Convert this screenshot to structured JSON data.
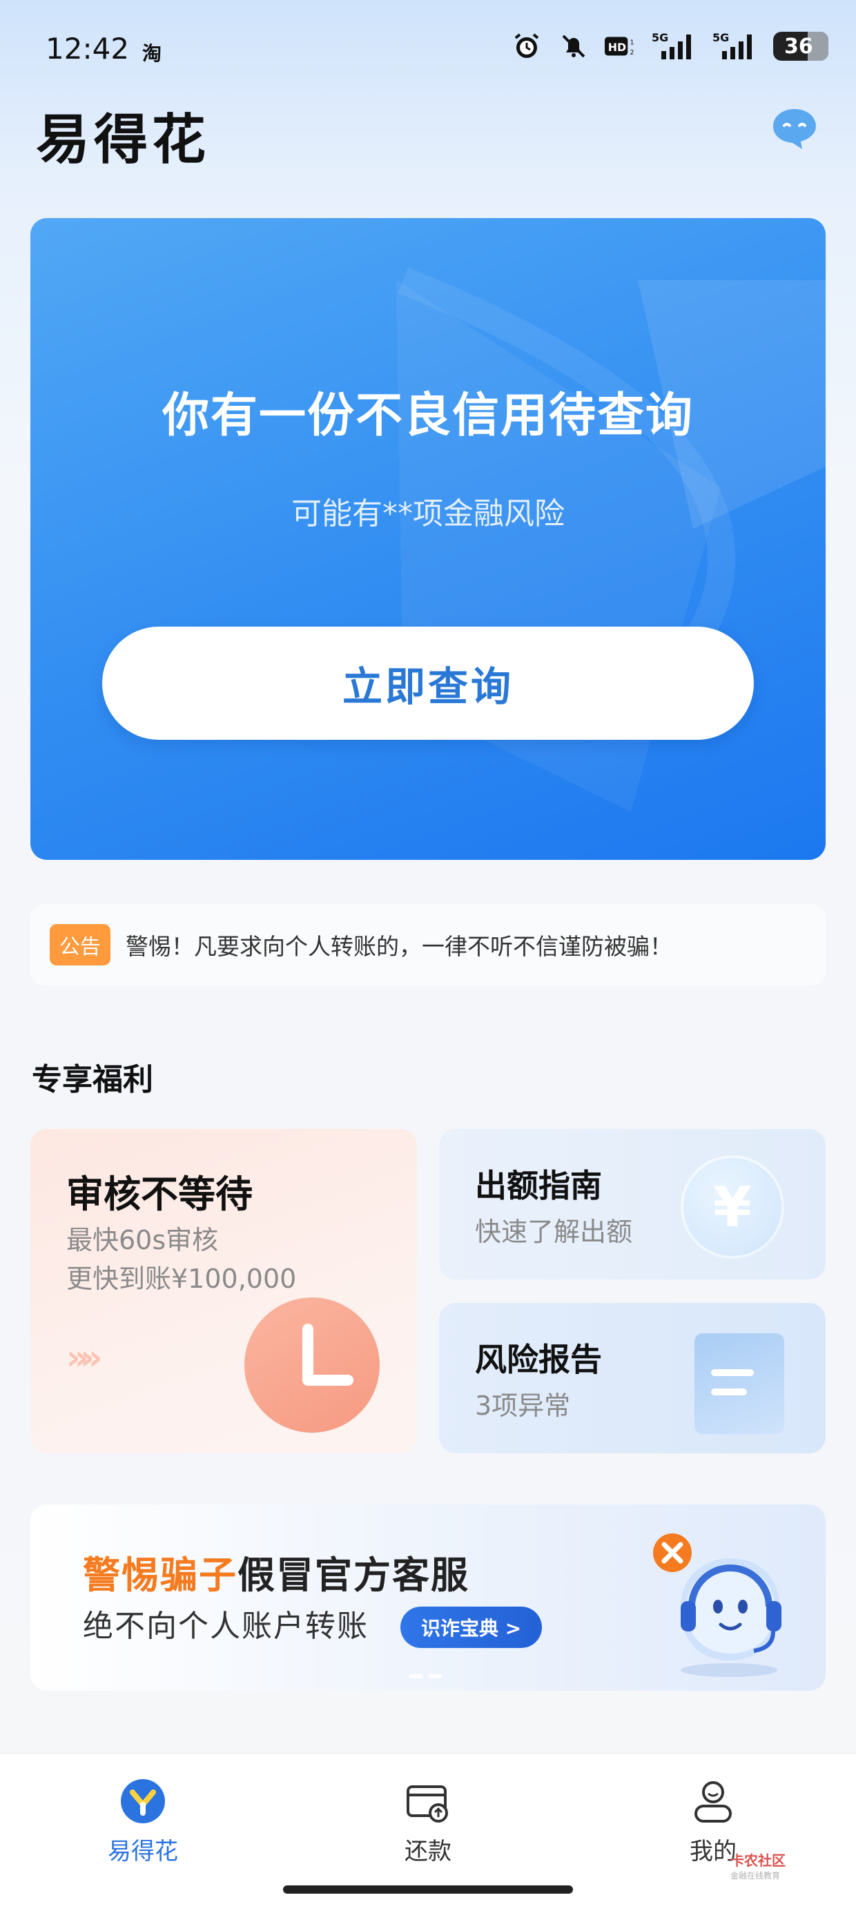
{
  "status_bar": {
    "time": "12:42",
    "app_indicator": "淘",
    "network_1": "5G",
    "network_2": "5G",
    "hd_label": "HD",
    "battery": "36"
  },
  "header": {
    "title": "易得花"
  },
  "hero": {
    "title": "你有一份不良信用待查询",
    "subtitle": "可能有**项金融风险",
    "button_label": "立即查询"
  },
  "notice": {
    "tag": "公告",
    "text": "警惕！凡要求向个人转账的，一律不听不信谨防被骗！"
  },
  "benefits": {
    "section_title": "专享福利",
    "review_card": {
      "title": "审核不等待",
      "line1": "最快60s审核",
      "line2": "更快到账¥100,000",
      "arrows": "»»"
    },
    "guide_card": {
      "title": "出额指南",
      "subtitle": "快速了解出额",
      "icon_glyph": "¥"
    },
    "risk_card": {
      "title": "风险报告",
      "subtitle": "3项异常"
    }
  },
  "banner": {
    "highlight": "警惕骗子",
    "headline_rest": "假冒官方客服",
    "line2": "绝不向个人账户转账",
    "button_label": "识诈宝典 >"
  },
  "bottom_nav": {
    "items": [
      {
        "label": "易得花",
        "active": true
      },
      {
        "label": "还款",
        "active": false
      },
      {
        "label": "我的",
        "active": false
      }
    ]
  },
  "watermark": {
    "text": "卡农社区",
    "sub": "金融在线教育"
  },
  "colors": {
    "primary": "#2b74e0",
    "hero_blue": "#3691f2",
    "warning_orange": "#f47b1f",
    "notice_tag": "#ff9a3d"
  }
}
